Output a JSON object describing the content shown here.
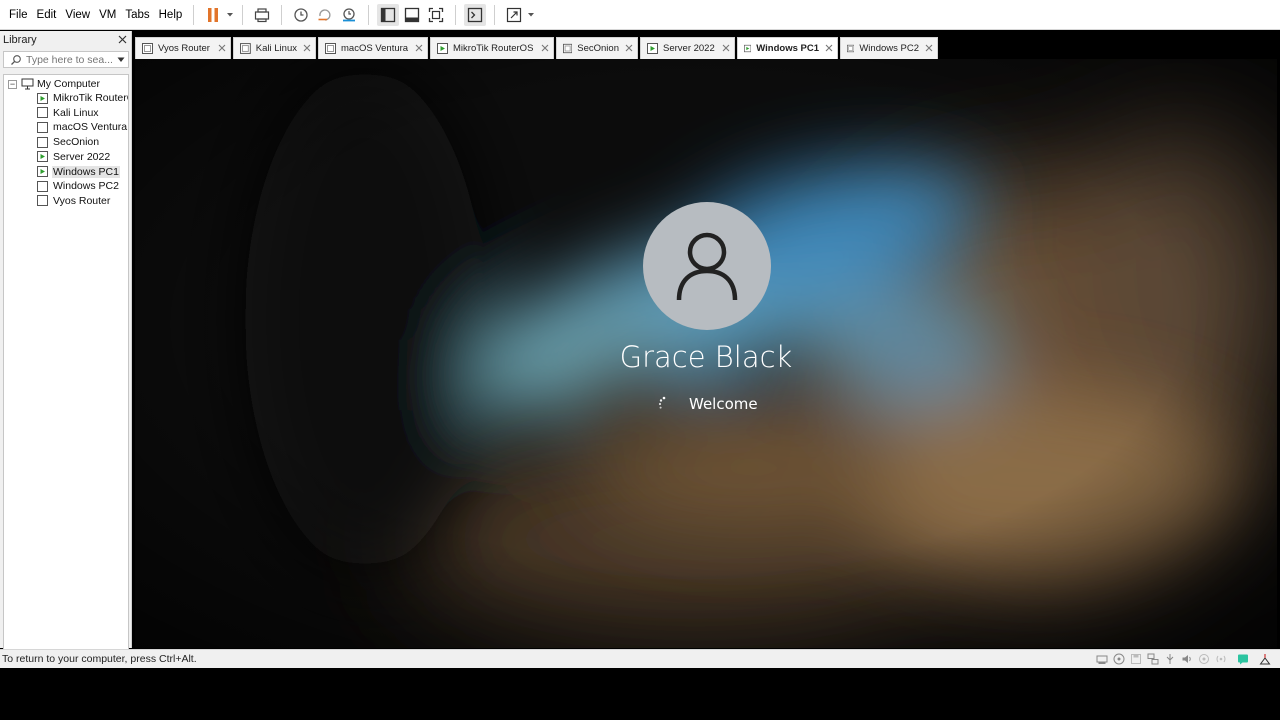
{
  "menu": {
    "items": [
      "File",
      "Edit",
      "View",
      "VM",
      "Tabs",
      "Help"
    ]
  },
  "toolbar": {
    "buttons": [
      {
        "name": "pause-vm-button",
        "icon": "pause-icon"
      },
      {
        "name": "send-ctrl-alt-del-button",
        "icon": "keyboard-icon"
      },
      {
        "name": "snapshot-button",
        "icon": "clock-icon"
      },
      {
        "name": "revert-snapshot-button",
        "icon": "revert-icon"
      },
      {
        "name": "snapshot-manager-button",
        "icon": "snapshot-manager-icon"
      },
      {
        "name": "show-library-button",
        "icon": "sidebar-icon"
      },
      {
        "name": "thumbnail-bar-button",
        "icon": "thumbnail-icon"
      },
      {
        "name": "full-screen-button",
        "icon": "fullscreen-icon"
      },
      {
        "name": "console-view-button",
        "icon": "terminal-icon"
      },
      {
        "name": "stretch-guest-button",
        "icon": "stretch-icon"
      }
    ]
  },
  "library": {
    "title": "Library",
    "search_placeholder": "Type here to sea...",
    "root_label": "My Computer",
    "items": [
      {
        "label": "MikroTik RouterOS",
        "running": true,
        "selected": false
      },
      {
        "label": "Kali Linux",
        "running": false,
        "selected": false
      },
      {
        "label": "macOS Ventura",
        "running": false,
        "selected": false
      },
      {
        "label": "SecOnion",
        "running": false,
        "selected": false
      },
      {
        "label": "Server 2022",
        "running": true,
        "selected": false
      },
      {
        "label": "Windows PC1",
        "running": true,
        "selected": true
      },
      {
        "label": "Windows PC2",
        "running": false,
        "selected": false
      },
      {
        "label": "Vyos Router",
        "running": false,
        "selected": false
      }
    ]
  },
  "tabs": [
    {
      "label": "Vyos Router",
      "active": false,
      "running": false
    },
    {
      "label": "Kali Linux",
      "active": false,
      "running": false
    },
    {
      "label": "macOS Ventura",
      "active": false,
      "running": false
    },
    {
      "label": "MikroTik RouterOS",
      "active": false,
      "running": true
    },
    {
      "label": "SecOnion",
      "active": false,
      "running": false
    },
    {
      "label": "Server 2022",
      "active": false,
      "running": true
    },
    {
      "label": "Windows PC1",
      "active": true,
      "running": true
    },
    {
      "label": "Windows PC2",
      "active": false,
      "running": false
    }
  ],
  "vm_screen": {
    "user_name": "Grace Black",
    "status_text": "Welcome"
  },
  "status_bar": {
    "text": "To return to your computer, press Ctrl+Alt.",
    "icons": [
      "hard-disk-icon",
      "cd-dvd-icon",
      "floppy-icon",
      "network-icon",
      "usb-icon",
      "sound-icon",
      "printer-icon",
      "display-icon",
      "message-icon",
      "full-screen-status-icon"
    ]
  },
  "colors": {
    "accent_running": "#2e9d2e",
    "pause_orange": "#e2742a"
  }
}
